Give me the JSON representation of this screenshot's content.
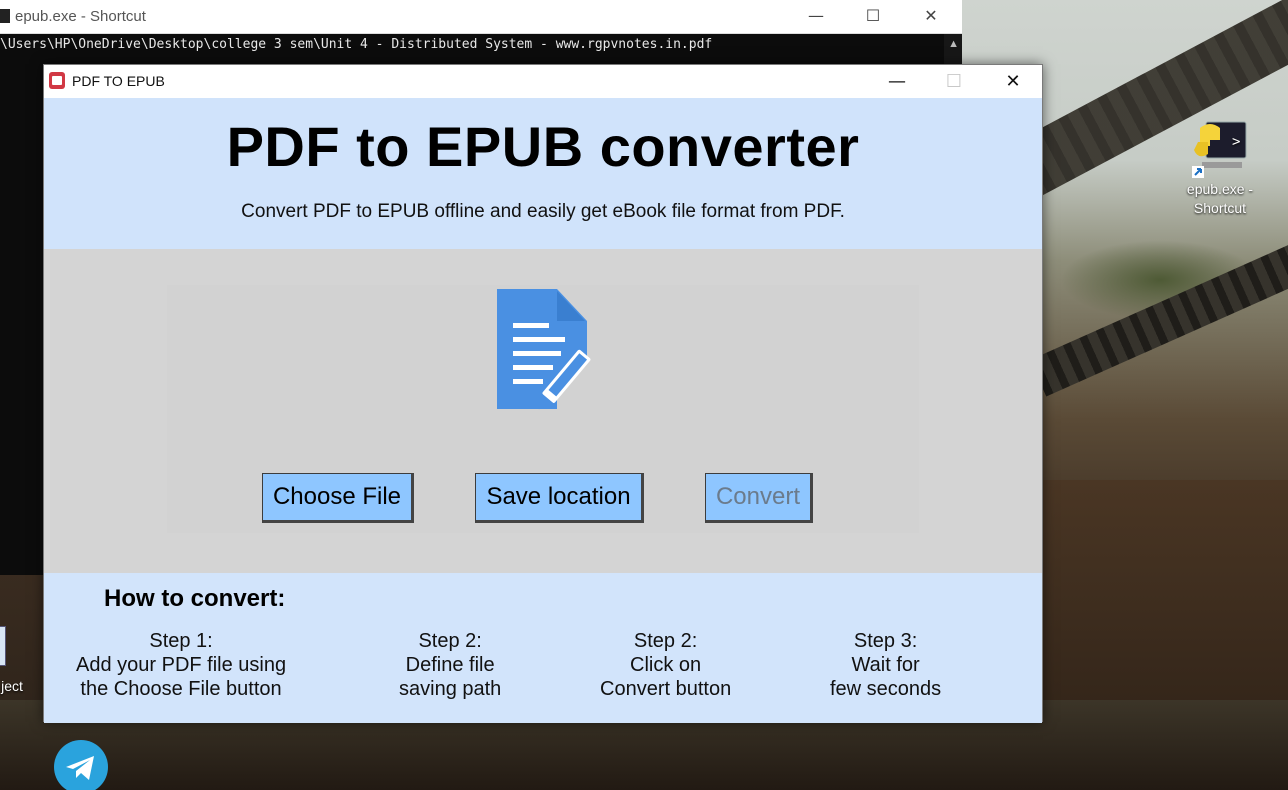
{
  "console": {
    "title": "epub.exe - Shortcut",
    "path_line": "\\Users\\HP\\OneDrive\\Desktop\\college 3 sem\\Unit 4 - Distributed System - www.rgpvnotes.in.pdf",
    "minimize": "—",
    "maximize": "☐",
    "close": "✕"
  },
  "app": {
    "window_title": "PDF TO EPUB",
    "minimize": "—",
    "maximize": "☐",
    "close": "✕",
    "heading": "PDF to EPUB converter",
    "subheading": "Convert PDF to EPUB offline and easily get eBook file format from PDF.",
    "buttons": {
      "choose_file": "Choose File",
      "save_location": "Save location",
      "convert": "Convert"
    },
    "howto": {
      "title": "How to convert:",
      "steps": [
        {
          "title": "Step 1:",
          "line1": "Add your PDF file using",
          "line2": "the Choose File button"
        },
        {
          "title": "Step 2:",
          "line1": "Define file",
          "line2": "saving path"
        },
        {
          "title": "Step 2:",
          "line1": "Click on",
          "line2": "Convert button"
        },
        {
          "title": "Step 3:",
          "line1": "Wait for",
          "line2": "few seconds"
        }
      ]
    },
    "colors": {
      "header_bg": "#d0e3fb",
      "workspace_bg": "#d4d4d4",
      "button_bg": "#8ec6ff",
      "doc_icon": "#4a90e2"
    }
  },
  "desktop": {
    "icons": [
      {
        "label_line1": "epub.exe -",
        "label_line2": "Shortcut",
        "icon": "python-console-icon"
      },
      {
        "label": "ject",
        "icon": "project-icon"
      },
      {
        "icon": "telegram-icon"
      }
    ]
  }
}
